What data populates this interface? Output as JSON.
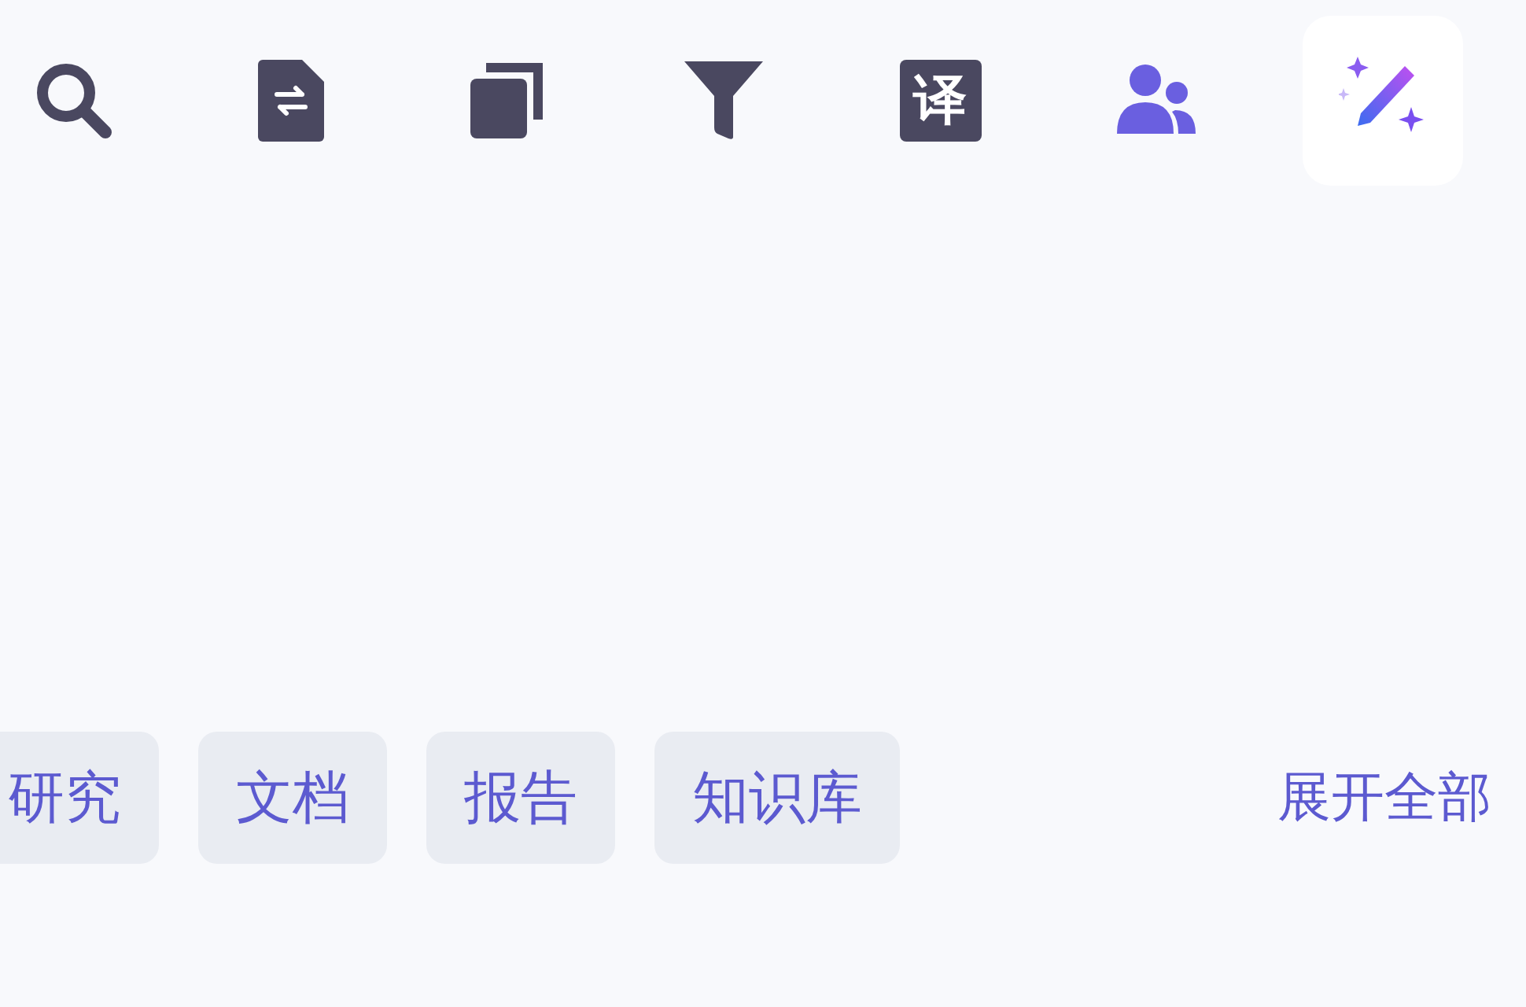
{
  "toolbar": [
    {
      "kind": "search",
      "selected": false
    },
    {
      "kind": "file-swap",
      "selected": false
    },
    {
      "kind": "copy",
      "selected": false
    },
    {
      "kind": "filter",
      "selected": false
    },
    {
      "kind": "translate",
      "glyph": "译",
      "selected": false
    },
    {
      "kind": "users",
      "selected": false
    },
    {
      "kind": "magic",
      "selected": true
    }
  ],
  "tags": [
    {
      "label": "研究"
    },
    {
      "label": "文档"
    },
    {
      "label": "报告"
    },
    {
      "label": "知识库"
    }
  ],
  "expand_link": "展开全部"
}
